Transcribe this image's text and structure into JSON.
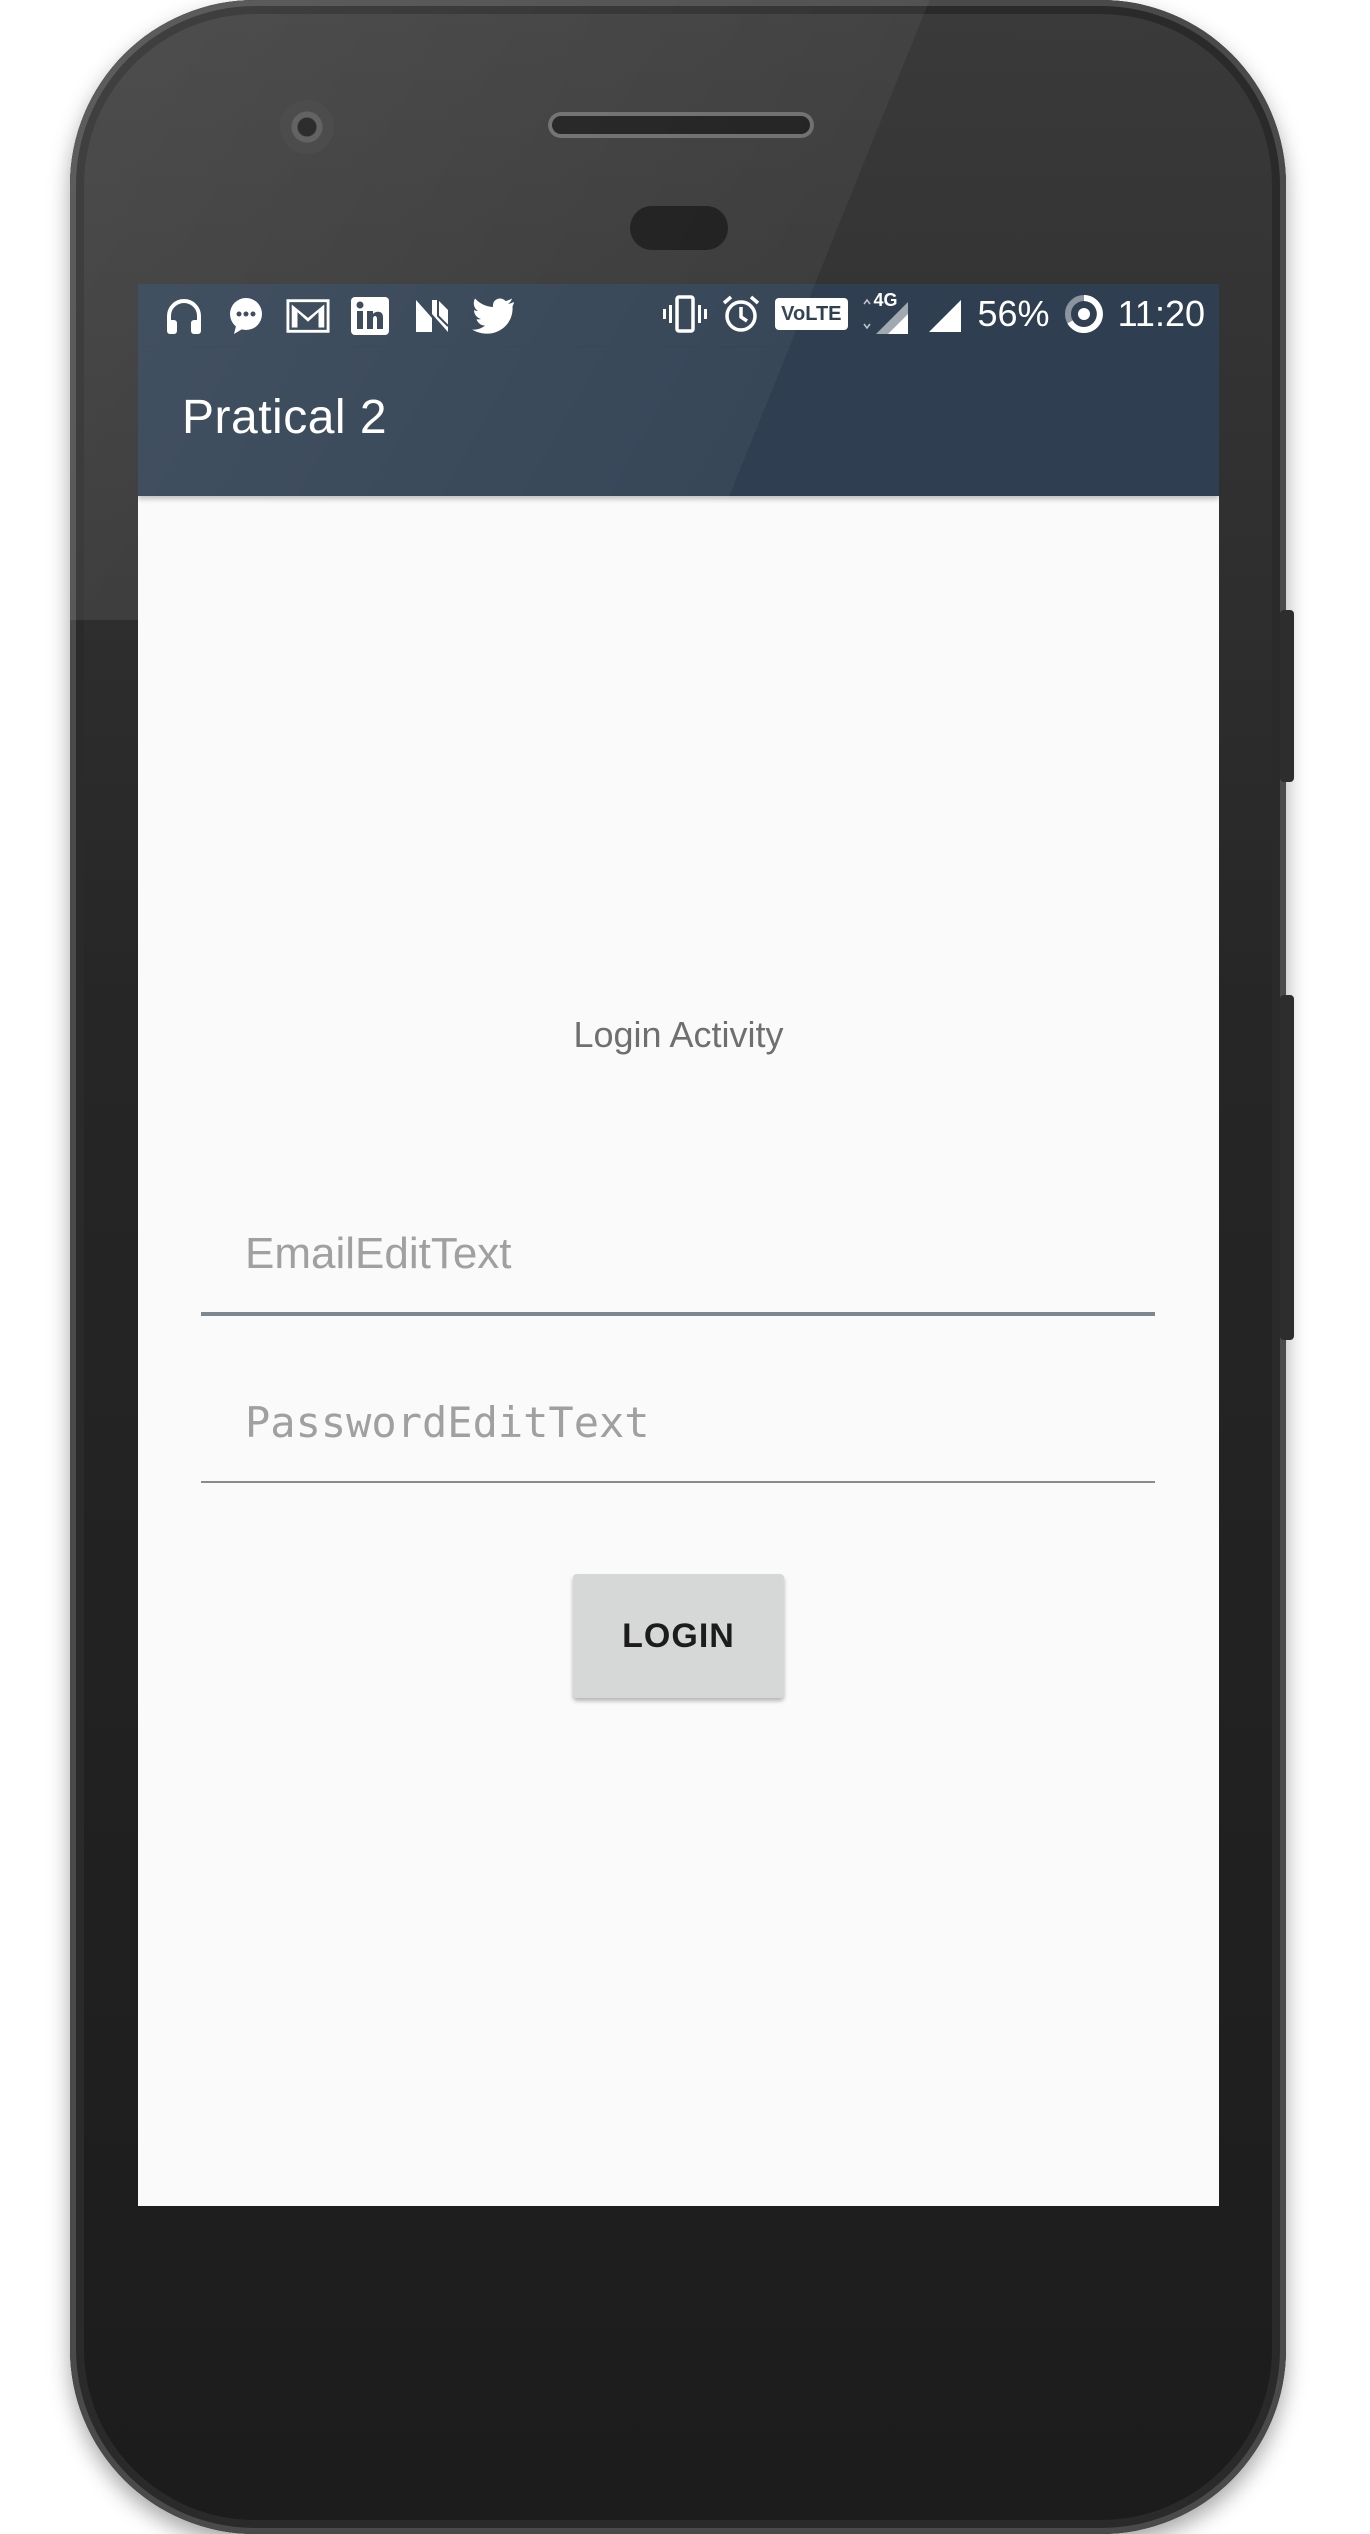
{
  "status_bar": {
    "battery_percent": "56%",
    "time": "11:20",
    "network_label": "4G",
    "volte_label": "VoLTE",
    "left_icons": [
      "headphones-icon",
      "chat-bubble-icon",
      "gmail-icon",
      "linkedin-icon",
      "n-app-icon",
      "twitter-icon"
    ],
    "right_icons": [
      "vibrate-icon",
      "alarm-icon",
      "volte-icon",
      "signal-4g-icon",
      "signal-icon",
      "battery-ring-icon"
    ]
  },
  "app_bar": {
    "title": "Pratical 2",
    "color": "#2f3f51"
  },
  "main": {
    "heading": "Login Activity",
    "email": {
      "placeholder": "EmailEditText",
      "value": ""
    },
    "password": {
      "placeholder": "PasswordEditText",
      "value": ""
    },
    "login_button": "LOGIN"
  }
}
